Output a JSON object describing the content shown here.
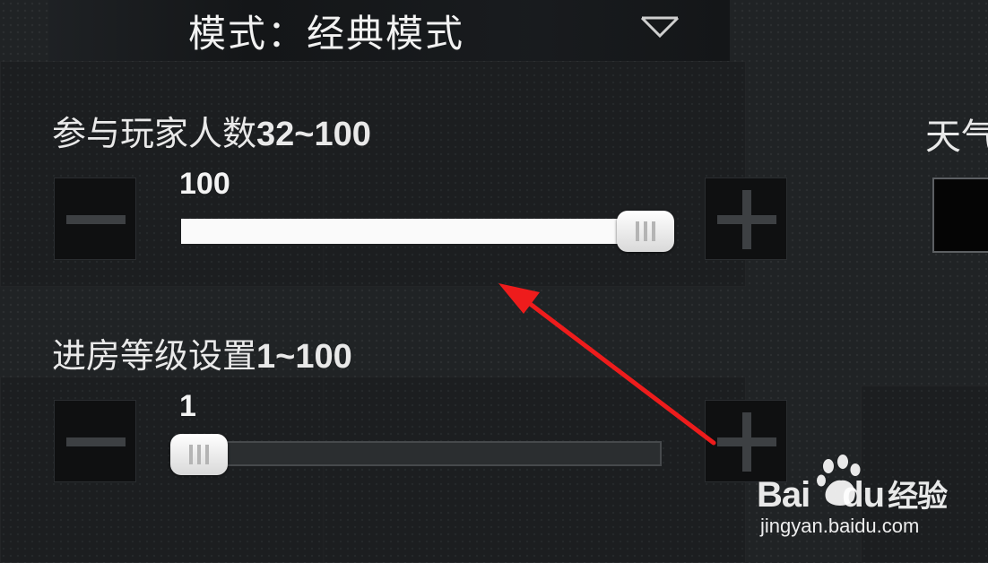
{
  "header": {
    "mode_label": "模式：经典模式",
    "dropdown_icon": "chevron-down-icon"
  },
  "player_count": {
    "label": "参与玩家人数",
    "range": "32~100",
    "value": "100",
    "min": 32,
    "max": 100,
    "current": 100,
    "minus_icon": "minus-icon",
    "plus_icon": "plus-icon"
  },
  "entry_level": {
    "label": "进房等级设置",
    "range": "1~100",
    "value": "1",
    "min": 1,
    "max": 100,
    "current": 1,
    "minus_icon": "minus-icon",
    "plus_icon": "plus-icon"
  },
  "weather": {
    "label_partial": "天气"
  },
  "annotation": {
    "icon": "red-arrow-annotation",
    "color": "#ee1c1c"
  },
  "watermark": {
    "brand_left": "Bai",
    "brand_mid": "du",
    "brand_right": "经验",
    "url": "jingyan.baidu.com"
  },
  "colors": {
    "background": "#202325",
    "track_fill": "#fafafa",
    "track_empty": "#2b2e30",
    "arrow": "#ee1c1c"
  }
}
